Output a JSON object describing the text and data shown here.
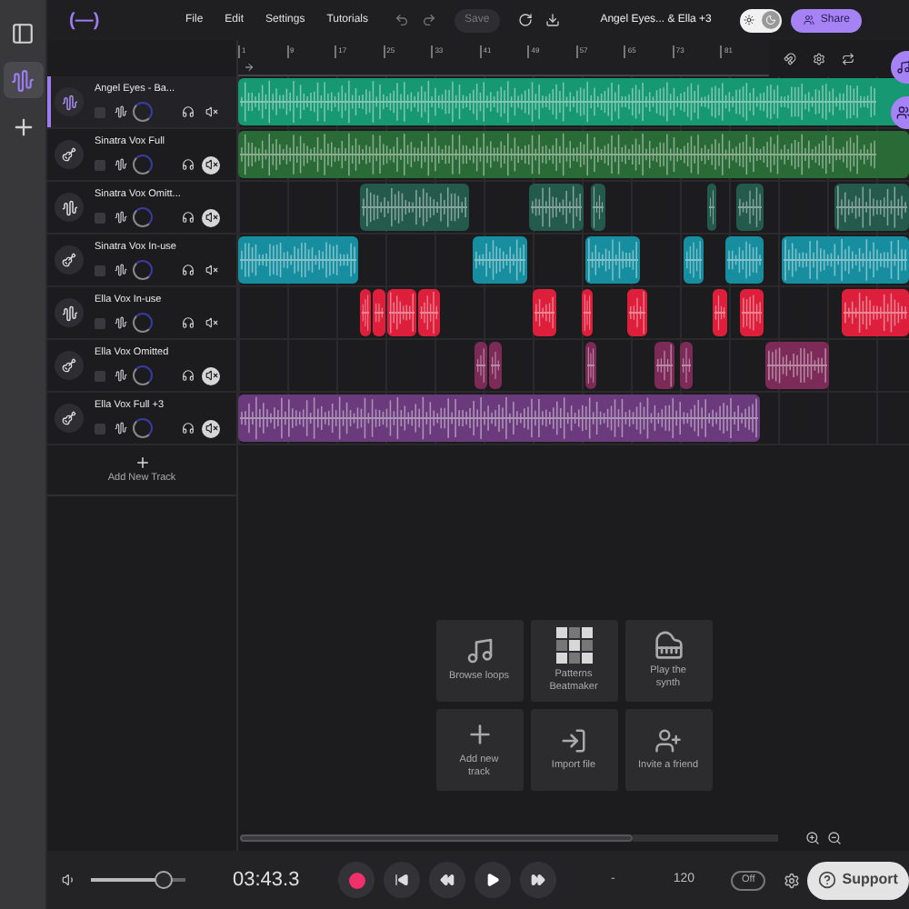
{
  "rail": [
    {
      "kind": "panel",
      "selected": false
    },
    {
      "kind": "tracks",
      "selected": true
    },
    {
      "kind": "add",
      "selected": false
    }
  ],
  "logo": "(—)",
  "menu": [
    "File",
    "Edit",
    "Settings",
    "Tutorials"
  ],
  "save": {
    "label": "Save",
    "disabled": true
  },
  "project_title": "Angel Eyes... & Ella +3",
  "theme": {
    "dark": true
  },
  "share": "Share",
  "ruler": [
    "1",
    "9",
    "17",
    "25",
    "33",
    "41",
    "49",
    "57",
    "65",
    "73",
    "81"
  ],
  "tracks": [
    {
      "name": "Angel Eyes - Ba...",
      "kind": "voice",
      "selected": true,
      "muted": false,
      "color": "#169873"
    },
    {
      "name": "Sinatra Vox Full",
      "kind": "instrument",
      "selected": false,
      "muted": true,
      "color": "#2a6a36"
    },
    {
      "name": "Sinatra Vox Omitt...",
      "kind": "voice",
      "selected": false,
      "muted": true,
      "color": "#245a4c"
    },
    {
      "name": "Sinatra Vox In-use",
      "kind": "instrument",
      "selected": false,
      "muted": false,
      "color": "#178ea0"
    },
    {
      "name": "Ella Vox In-use",
      "kind": "voice",
      "selected": false,
      "muted": false,
      "color": "#de1f3c"
    },
    {
      "name": "Ella Vox Omitted",
      "kind": "instrument",
      "selected": false,
      "muted": true,
      "color": "#7c2a58"
    },
    {
      "name": "Ella Vox Full +3",
      "kind": "instrument",
      "selected": false,
      "muted": true,
      "color": "#6a3a7c"
    }
  ],
  "add_track": "Add New Track",
  "actions": [
    {
      "kind": "loops",
      "label": "Browse loops"
    },
    {
      "kind": "patterns",
      "label": "Patterns Beatmaker"
    },
    {
      "kind": "synth",
      "label": "Play the synth"
    },
    {
      "kind": "add",
      "label": "Add new track"
    },
    {
      "kind": "import",
      "label": "Import file"
    },
    {
      "kind": "invite",
      "label": "Invite a friend"
    }
  ],
  "transport": {
    "volume": {
      "level": 0.77
    },
    "time": "03:43.3",
    "key": "-",
    "bpm": "120",
    "metronome": {
      "label": "Off",
      "on": false
    },
    "support": "Support"
  }
}
